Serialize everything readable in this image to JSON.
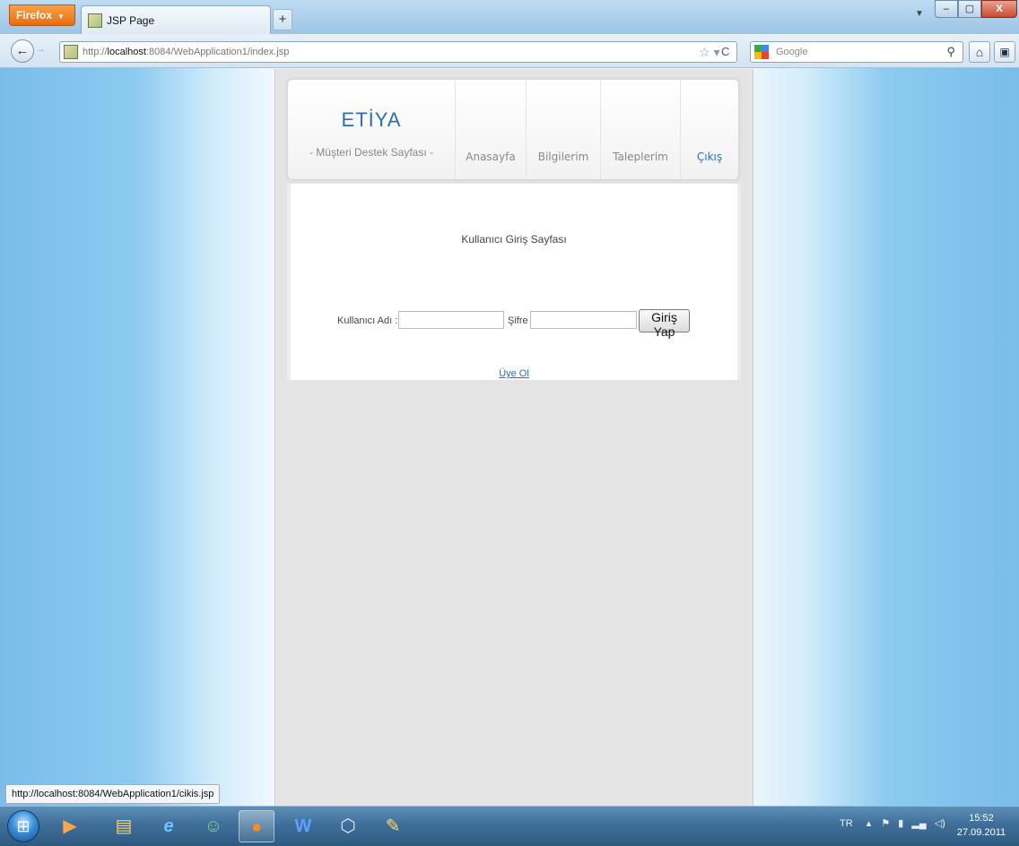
{
  "browser": {
    "app_menu": "Firefox",
    "tab_title": "JSP Page",
    "new_tab": "+",
    "url_prefix": "http://",
    "url_host": "localhost",
    "url_rest": ":8084/WebApplication1/index.jsp",
    "search_placeholder": "Google",
    "window_controls": {
      "minimize": "–",
      "maximize": "▢",
      "close": "X"
    }
  },
  "page": {
    "logo_title": "ETİYA",
    "logo_subtitle": "- Müşteri Destek Sayfası -",
    "nav": [
      "Anasayfa",
      "Bilgilerim",
      "Taleplerim",
      "Çıkış"
    ],
    "login_title": "Kullanıcı Giriş Sayfası",
    "username_label": "Kullanıcı Adı :",
    "username_value": "",
    "password_label": "Şifre :",
    "password_value": "",
    "login_button": "Giriş Yap",
    "register_link": "Üye Ol"
  },
  "status_url": "http://localhost:8084/WebApplication1/cikis.jsp",
  "taskbar": {
    "language": "TR",
    "time": "15:52",
    "date": "27.09.2011"
  },
  "colors": {
    "accent": "#2c6fb3",
    "firefox_orange": "#e66e10",
    "page_bg": "#e4e4e4"
  },
  "icons": [
    "site-icon",
    "star-icon",
    "reload-icon",
    "google-icon",
    "search-icon",
    "home-icon",
    "addon-icon",
    "windows-start-icon",
    "media-player-icon",
    "explorer-icon",
    "internet-explorer-icon",
    "messenger-icon",
    "firefox-icon",
    "word-icon",
    "virtualbox-icon",
    "paint-icon"
  ]
}
